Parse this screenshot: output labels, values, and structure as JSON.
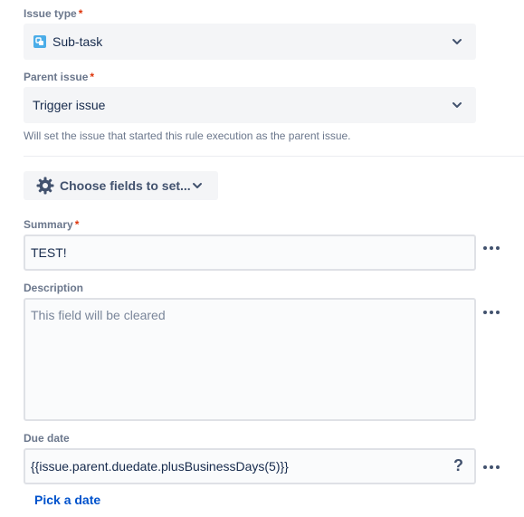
{
  "issue_type": {
    "label": "Issue type",
    "required_mark": "*",
    "value": "Sub-task",
    "icon": "subtask-icon"
  },
  "parent_issue": {
    "label": "Parent issue",
    "required_mark": "*",
    "value": "Trigger issue",
    "helper": "Will set the issue that started this rule execution as the parent issue."
  },
  "choose_fields": {
    "label": "Choose fields to set...",
    "icon": "gear-icon"
  },
  "summary": {
    "label": "Summary",
    "required_mark": "*",
    "value": "TEST!"
  },
  "description": {
    "label": "Description",
    "placeholder": "This field will be cleared"
  },
  "due_date": {
    "label": "Due date",
    "value": "{{issue.parent.duedate.plusBusinessDays(5)}}",
    "help_symbol": "?",
    "pick_link": "Pick a date"
  },
  "colors": {
    "label": "#6b778c",
    "required": "#de350b",
    "link": "#0052cc",
    "select_bg": "#f4f5f7",
    "subtask_icon": "#4bade8"
  }
}
